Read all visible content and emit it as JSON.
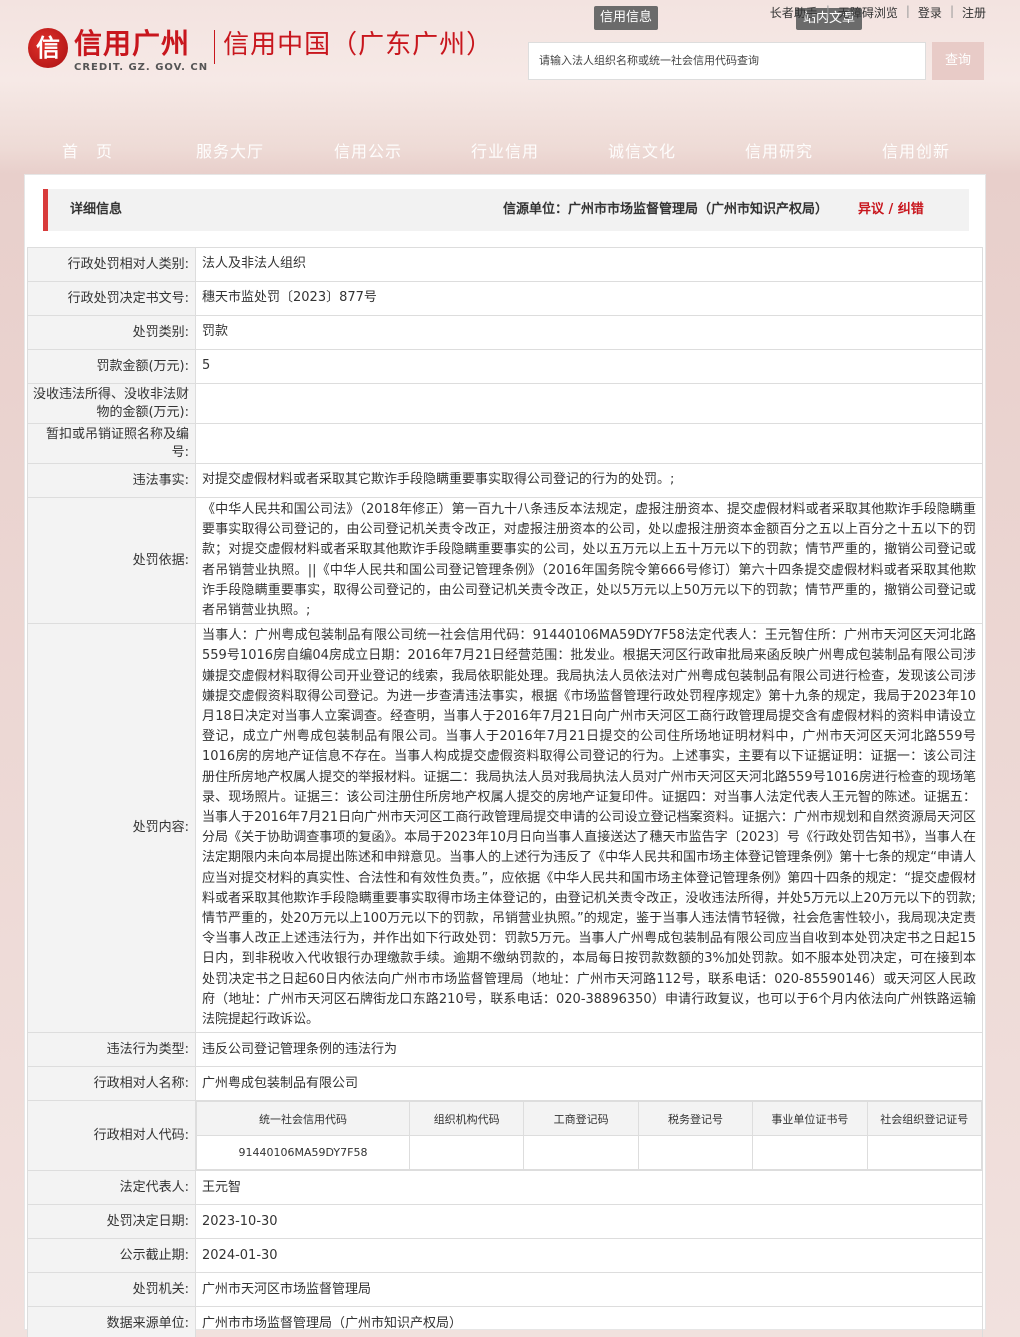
{
  "header": {
    "logo_mark": "信",
    "logo_cn": "信用广州",
    "logo_en": "CREDIT. GZ. GOV. CN",
    "logo_sub": "信用中国（广东广州）",
    "top_links": [
      "长者助手",
      "无障碍浏览",
      "登录",
      "注册"
    ],
    "tab_info": "信用信息",
    "tab_site": "站内文章",
    "search_placeholder": "请输入法人组织名称或统一社会信用代码查询",
    "search_button": "查询"
  },
  "nav": [
    "首　页",
    "服务大厅",
    "信用公示",
    "行业信用",
    "诚信文化",
    "信用研究",
    "信用创新"
  ],
  "detail": {
    "title": "详细信息",
    "source": "信源单位：广州市市场监督管理局（广州市知识产权局）",
    "objection": "异议 / 纠错"
  },
  "rows": [
    {
      "label": "行政处罚相对人类别:",
      "value": "法人及非法人组织"
    },
    {
      "label": "行政处罚决定书文号:",
      "value": "穗天市监处罚〔2023〕877号"
    },
    {
      "label": "处罚类别:",
      "value": "罚款"
    },
    {
      "label": "罚款金额(万元):",
      "value": "5"
    },
    {
      "label": "没收违法所得、没收非法财物的金额(万元):",
      "value": ""
    },
    {
      "label": "暂扣或吊销证照名称及编号:",
      "value": ""
    },
    {
      "label": "违法事实:",
      "value": "对提交虚假材料或者采取其它欺诈手段隐瞒重要事实取得公司登记的行为的处罚。;"
    },
    {
      "label": "处罚依据:",
      "value": "《中华人民共和国公司法》（2018年修正）第一百九十八条违反本法规定，虚报注册资本、提交虚假材料或者采取其他欺诈手段隐瞒重要事实取得公司登记的，由公司登记机关责令改正，对虚报注册资本的公司，处以虚报注册资本金额百分之五以上百分之十五以下的罚款；对提交虚假材料或者采取其他欺诈手段隐瞒重要事实的公司，处以五万元以上五十万元以下的罚款；情节严重的，撤销公司登记或者吊销营业执照。||《中华人民共和国公司登记管理条例》（2016年国务院令第666号修订）第六十四条提交虚假材料或者采取其他欺诈手段隐瞒重要事实，取得公司登记的，由公司登记机关责令改正，处以5万元以上50万元以下的罚款；情节严重的，撤销公司登记或者吊销营业执照。;"
    },
    {
      "label": "处罚内容:",
      "value": "当事人：广州粤成包装制品有限公司统一社会信用代码：91440106MA59DY7F58法定代表人：王元智住所：广州市天河区天河北路559号1016房自编04房成立日期：2016年7月21日经营范围：批发业。根据天河区行政审批局来函反映广州粤成包装制品有限公司涉嫌提交虚假材料取得公司开业登记的线索，我局依职能处理。我局执法人员依法对广州粤成包装制品有限公司进行检查，发现该公司涉嫌提交虚假资料取得公司登记。为进一步查清违法事实，根据《市场监督管理行政处罚程序规定》第十九条的规定，我局于2023年10月18日决定对当事人立案调查。经查明，当事人于2016年7月21日向广州市天河区工商行政管理局提交含有虚假材料的资料申请设立登记，成立广州粤成包装制品有限公司。当事人于2016年7月21日提交的公司住所场地证明材料中，广州市天河区天河北路559号1016房的房地产证信息不存在。当事人构成提交虚假资料取得公司登记的行为。上述事实，主要有以下证据证明：证据一：该公司注册住所房地产权属人提交的举报材料。证据二：我局执法人员对我局执法人员对广州市天河区天河北路559号1016房进行检查的现场笔录、现场照片。证据三：该公司注册住所房地产权属人提交的房地产证复印件。证据四：对当事人法定代表人王元智的陈述。证据五：当事人于2016年7月21日向广州市天河区工商行政管理局提交申请的公司设立登记档案资料。证据六：广州市规划和自然资源局天河区分局《关于协助调查事项的复函》。本局于2023年10月日向当事人直接送达了穗天市监告字〔2023〕号《行政处罚告知书》，当事人在法定期限内未向本局提出陈述和申辩意见。当事人的上述行为违反了《中华人民共和国市场主体登记管理条例》第十七条的规定“申请人应当对提交材料的真实性、合法性和有效性负责。”，应依据《中华人民共和国市场主体登记管理条例》第四十四条的规定：“提交虚假材料或者采取其他欺诈手段隐瞒重要事实取得市场主体登记的，由登记机关责令改正，没收违法所得，并处5万元以上20万元以下的罚款;情节严重的，处20万元以上100万元以下的罚款，吊销营业执照。”的规定，鉴于当事人违法情节轻微，社会危害性较小，我局现决定责令当事人改正上述违法行为，并作出如下行政处罚：罚款5万元。当事人广州粤成包装制品有限公司应当自收到本处罚决定书之日起15日内，到非税收入代收银行办理缴款手续。逾期不缴纳罚款的，本局每日按罚款数额的3%加处罚款。如不服本处罚决定，可在接到本处罚决定书之日起60日内依法向广州市市场监督管理局（地址：广州市天河路112号，联系电话：020-85590146）或天河区人民政府（地址：广州市天河区石牌街龙口东路210号，联系电话：020-38896350）申请行政复议，也可以于6个月内依法向广州铁路运输法院提起行政诉讼。"
    },
    {
      "label": "违法行为类型:",
      "value": "违反公司登记管理条例的违法行为"
    },
    {
      "label": "行政相对人名称:",
      "value": "广州粤成包装制品有限公司"
    }
  ],
  "codes": {
    "label": "行政相对人代码:",
    "headers": [
      "统一社会信用代码",
      "组织机构代码",
      "工商登记码",
      "税务登记号",
      "事业单位证书号",
      "社会组织登记证号"
    ],
    "values": [
      "91440106MA59DY7F58",
      "",
      "",
      "",
      "",
      ""
    ]
  },
  "rows2": [
    {
      "label": "法定代表人:",
      "value": "王元智"
    },
    {
      "label": "处罚决定日期:",
      "value": "2023-10-30"
    },
    {
      "label": "公示截止期:",
      "value": "2024-01-30"
    },
    {
      "label": "处罚机关:",
      "value": "广州市天河区市场监督管理局"
    },
    {
      "label": "数据来源单位:",
      "value": "广州市市场监督管理局（广州市知识产权局）"
    }
  ]
}
